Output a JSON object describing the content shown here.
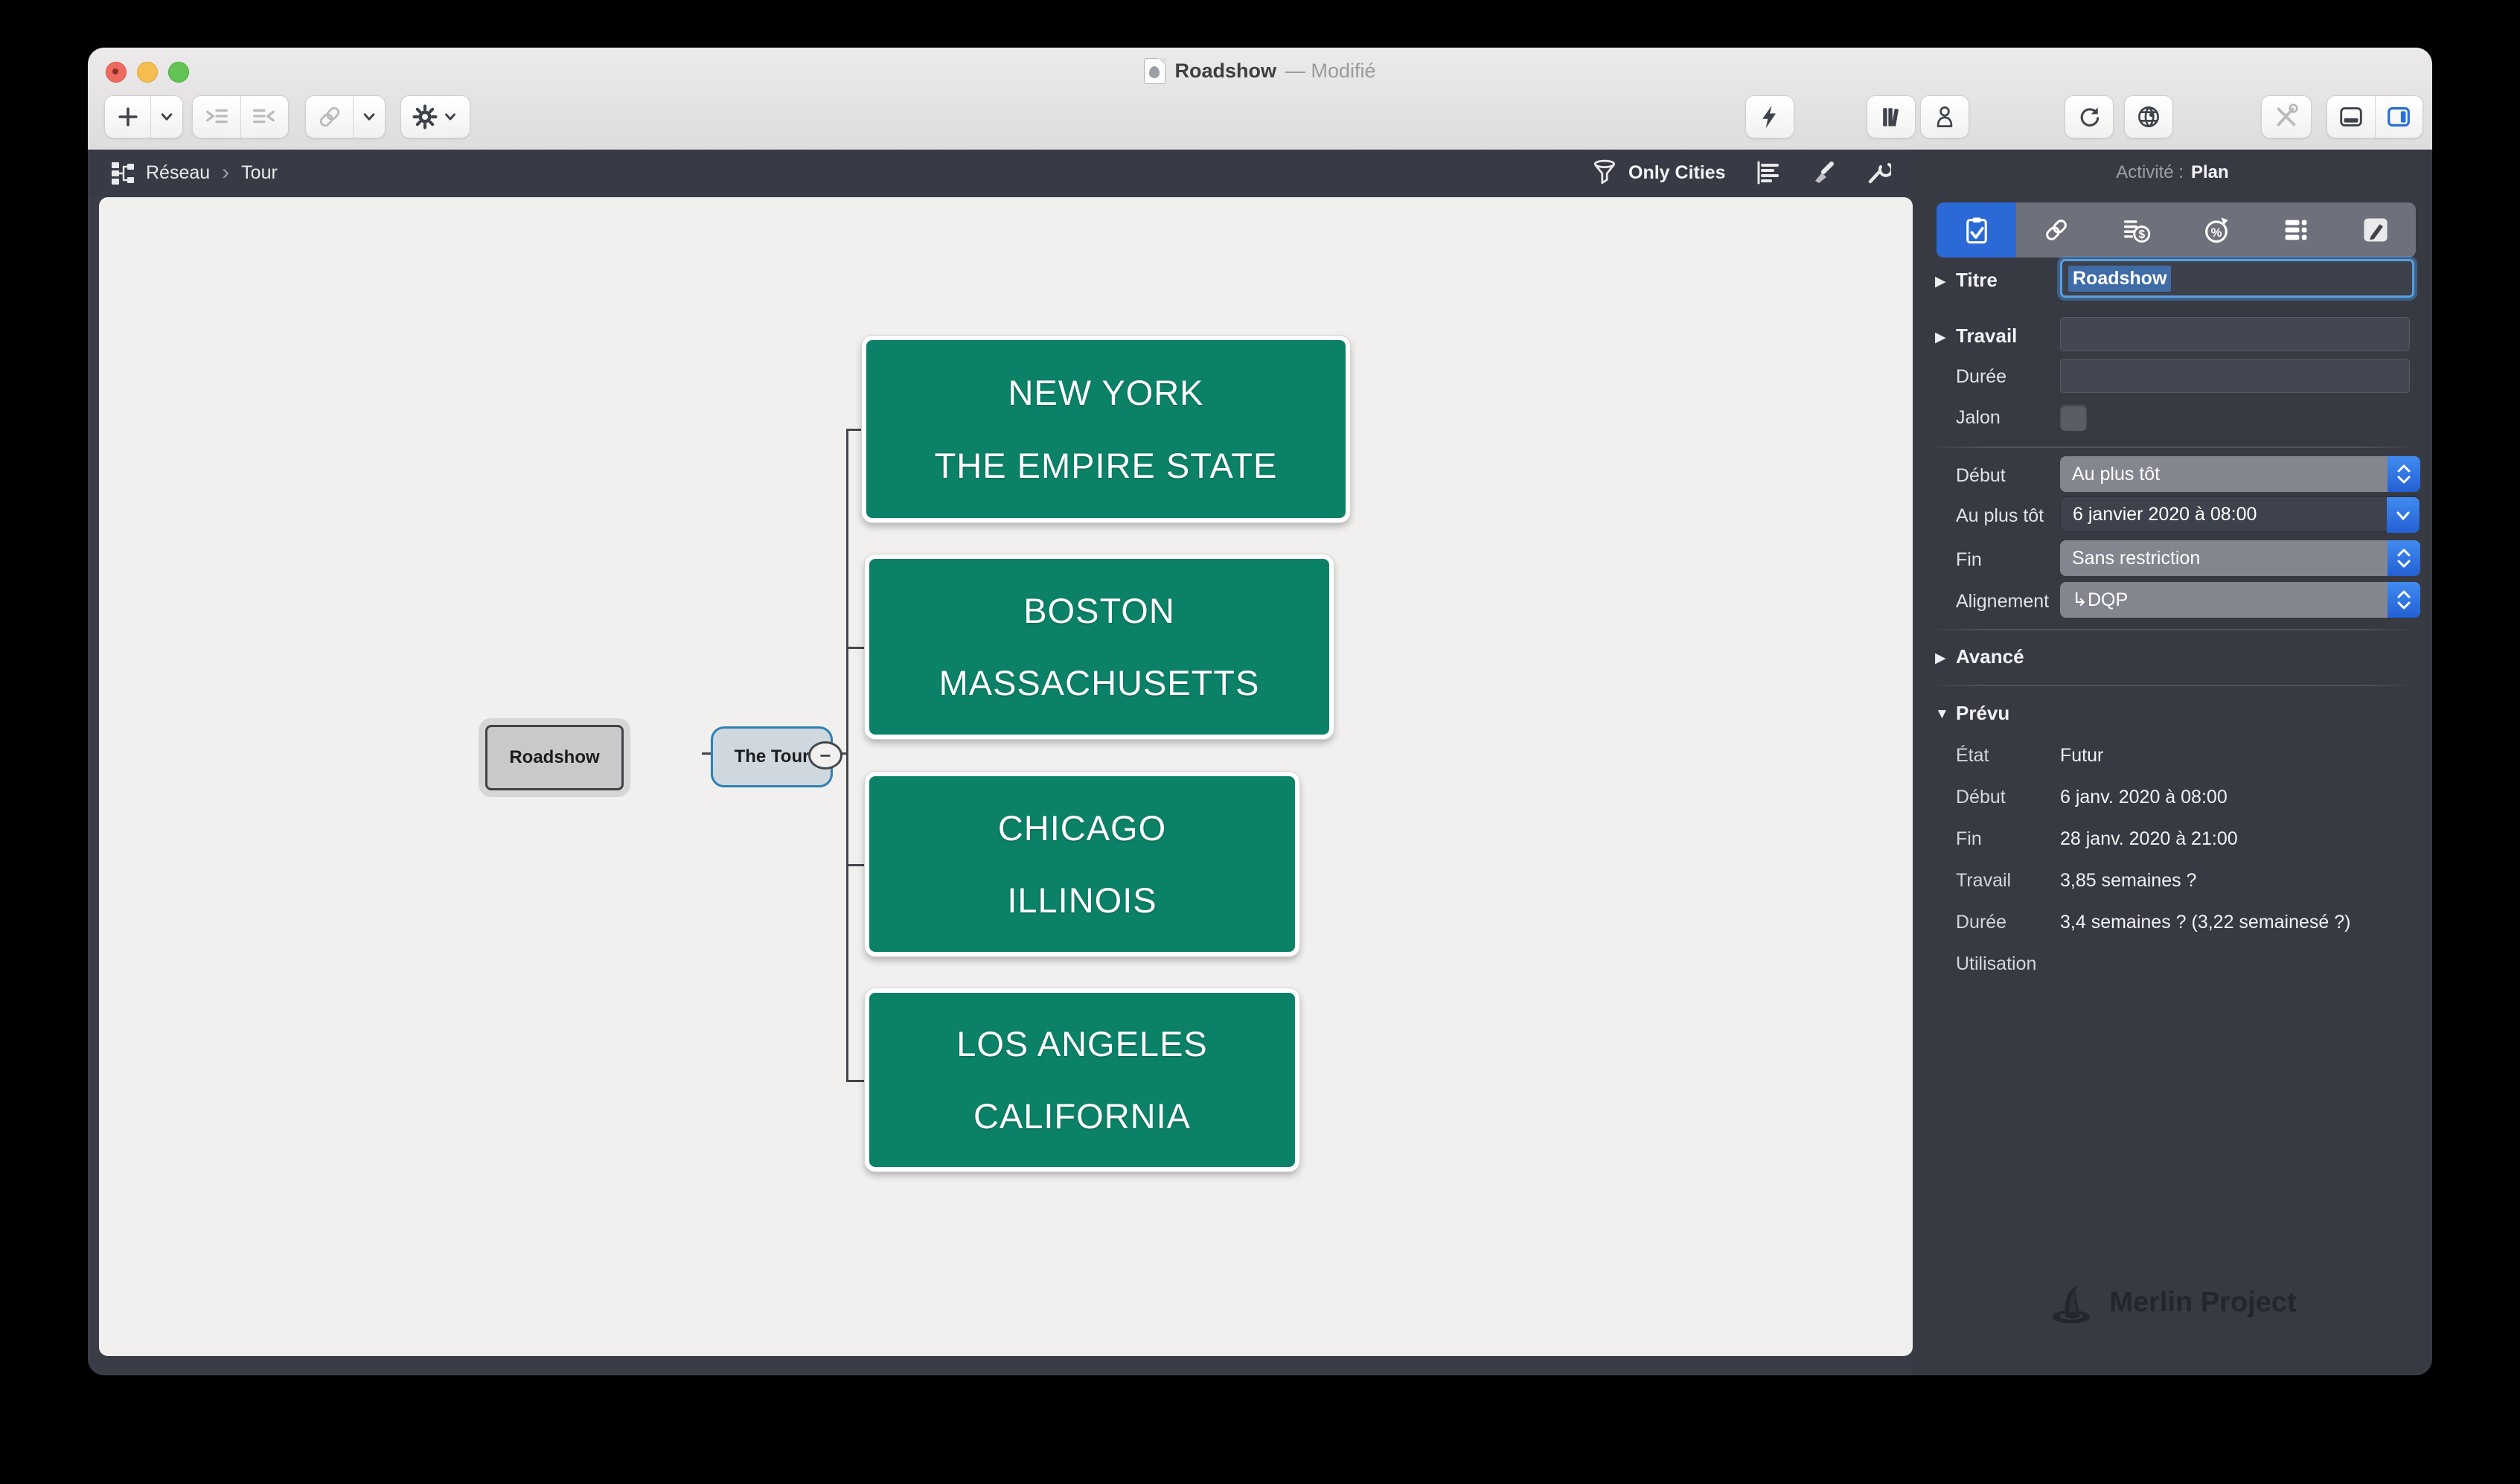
{
  "window": {
    "title": "Roadshow",
    "status": "— Modifié"
  },
  "breadcrumb": {
    "view": "Réseau",
    "separator": "›",
    "item": "Tour"
  },
  "view_toolbar": {
    "filter_label": "Only Cities"
  },
  "canvas": {
    "root_node": "Roadshow",
    "group_node": "The Tour",
    "collapse_glyph": "−",
    "box_color": "#0B8168",
    "boxes": [
      {
        "line1": "NEW YORK",
        "line2": "THE EMPIRE STATE"
      },
      {
        "line1": "BOSTON",
        "line2": "MASSACHUSETTS"
      },
      {
        "line1": "CHICAGO",
        "line2": "ILLINOIS"
      },
      {
        "line1": "LOS ANGELES",
        "line2": "CALIFORNIA"
      }
    ]
  },
  "inspector": {
    "header": {
      "label": "Activité :",
      "value": "Plan"
    },
    "tabs": [
      "clipboard-check",
      "link",
      "cost",
      "progress",
      "rows",
      "style-pencil"
    ],
    "titre": {
      "label": "Titre",
      "value": "Roadshow"
    },
    "travail": {
      "label": "Travail",
      "value": ""
    },
    "duree": {
      "label": "Durée",
      "value": ""
    },
    "jalon": {
      "label": "Jalon",
      "checked": false
    },
    "debut": {
      "label": "Début",
      "value": "Au plus tôt"
    },
    "au_plus_tot": {
      "label": "Au plus tôt",
      "value": "6 janvier 2020 à 08:00"
    },
    "fin": {
      "label": "Fin",
      "value": "Sans restriction"
    },
    "alignement": {
      "label": "Alignement",
      "value": "↳DQP"
    },
    "avance_label": "Avancé",
    "prevu_label": "Prévu",
    "prevu_rows": [
      {
        "label": "État",
        "value": "Futur"
      },
      {
        "label": "Début",
        "value": "6 janv. 2020 à 08:00"
      },
      {
        "label": "Fin",
        "value": "28 janv. 2020 à 21:00"
      },
      {
        "label": "Travail",
        "value": "3,85 semaines ?"
      },
      {
        "label": "Durée",
        "value": "3,4 semaines ? (3,22 semainesé ?)"
      },
      {
        "label": "Utilisation",
        "value": ""
      }
    ],
    "watermark": "Merlin Project"
  },
  "icons": {
    "disclosure_collapsed": "▶",
    "disclosure_expanded": "▼"
  },
  "colors": {
    "accent_blue": "#2a6fd6",
    "box_green": "#0B8168",
    "selection_blue": "#3f6ca6",
    "panel_dark": "#373a43"
  }
}
